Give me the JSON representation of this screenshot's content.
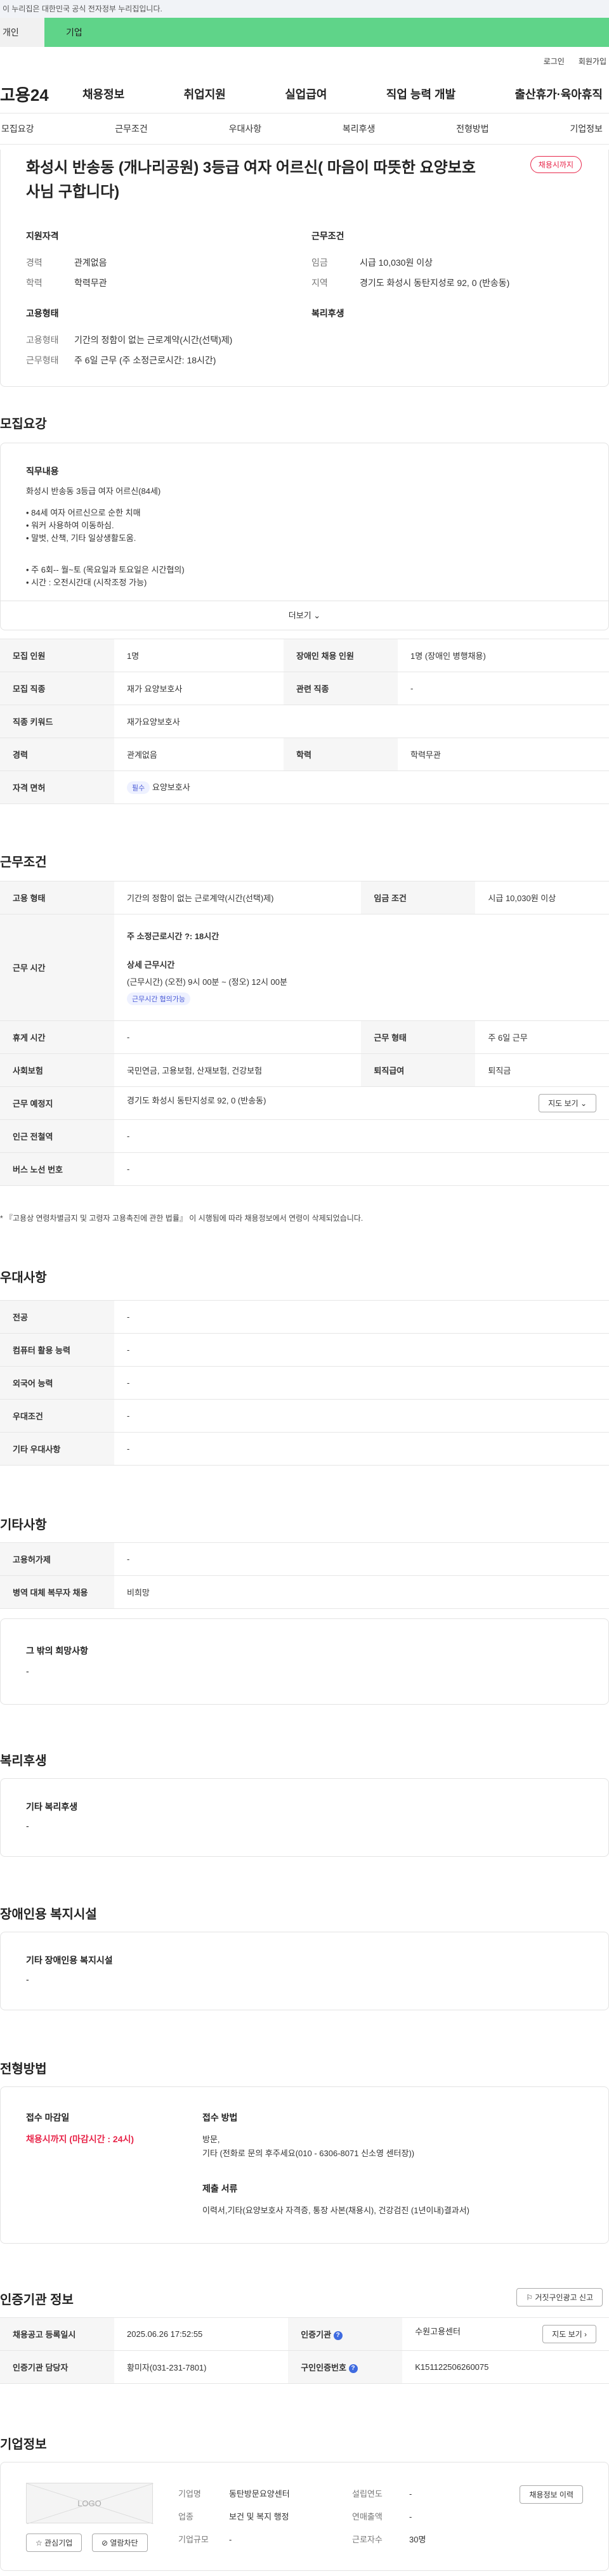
{
  "gov_banner": "이 누리집은 대한민국 공식 전자정부 누리집입니다.",
  "tabs": {
    "tab1": "개인",
    "tab2": "기업"
  },
  "util": {
    "login": "로그인",
    "signup": "회원가입"
  },
  "logo": "고용24",
  "gnb": [
    "채용정보",
    "취업지원",
    "실업급여",
    "직업 능력 개발",
    "출산휴가·육아휴직"
  ],
  "subnav": [
    "모집요강",
    "근무조건",
    "우대사항",
    "복리후생",
    "전형방법",
    "기업정보"
  ],
  "hero": {
    "title": "화성시 반송동 (개나리공원) 3등급 여자 어르신( 마음이 따뜻한 요양보호사님 구합니다)",
    "badge": "채용시까지",
    "qual_title": "지원자격",
    "career_k": "경력",
    "career_v": "관계없음",
    "edu_k": "학력",
    "edu_v": "학력무관",
    "emp_title": "고용형태",
    "emptype_k": "고용형태",
    "emptype_v": "기간의 정함이 없는 근로계약(시간(선택)제)",
    "worktype_k": "근무형태",
    "worktype_v": "주 6일 근무 (주 소정근로시간: 18시간)",
    "cond_title": "근무조건",
    "wage_k": "임금",
    "wage_v": "시급 10,030원 이상",
    "area_k": "지역",
    "area_v": "경기도 화성시 동탄지성로 92, 0 (반송동)",
    "welfare_title": "복리후생"
  },
  "recruit": {
    "section": "모집요강",
    "job_title": "직무내용",
    "lines": [
      "화성시 반송동 3등급 여자 어르신(84세)",
      "• 84세 여자 어르신으로 순한 치매",
      "• 워커 사용하여 이동하심.",
      "• 말벗, 산책, 기타 일상생활도움.",
      "• 주 6회-- 월~토 (목요일과 토요일은 시간협의)",
      "• 시간 : 오전시간대 (시작조정 가능)"
    ],
    "more": "더보기",
    "rows": [
      {
        "k1": "모집 인원",
        "v1": "1명",
        "k2": "장애인 채용 인원",
        "v2": "1명 (장애인 병행채용)"
      },
      {
        "k1": "모집 직종",
        "v1": "재가 요양보호사",
        "k2": "관련 직종",
        "v2": "-"
      },
      {
        "k1": "직종 키워드",
        "v1": "재가요양보호사"
      },
      {
        "k1": "경력",
        "v1": "관계없음",
        "k2": "학력",
        "v2": "학력무관"
      },
      {
        "k1": "자격 면허",
        "chip": "필수",
        "v1": "요양보호사"
      }
    ]
  },
  "work": {
    "section": "근무조건",
    "emptype_k": "고용 형태",
    "emptype_v": "기간의 정함이 없는 근로계약(시간(선택)제)",
    "wage_k": "임금 조건",
    "wage_v": "시급 10,030원 이상",
    "hours_k": "근무 시간",
    "hours_weekly": "주 소정근로시간 ?: 18시간",
    "hours_detail_title": "상세 근무시간",
    "hours_detail": "(근무시간) (오전) 9시 00분 ~ (정오) 12시 00분",
    "hours_chip": "근무시간 협의가능",
    "holiday_k": "휴게 시간",
    "holiday_v": "-",
    "form_k": "근무 형태",
    "form_v": "주 6일 근무",
    "insurance_k": "사회보험",
    "insurance_v": "국민연금, 고용보험, 산재보험, 건강보험",
    "retire_k": "퇴직급여",
    "retire_v": "퇴직금",
    "place_k": "근무 예정지",
    "place_v": "경기도 화성시 동탄지성로 92, 0 (반송동)",
    "map_btn": "지도 보기",
    "station_k": "인근 전철역",
    "station_v": "-",
    "bus_k": "버스 노선 번호",
    "bus_v": "-",
    "note": "* 『고용상 연령차별금지 및 고령자 고용촉진에 관한 법률』 이 시행됨에 따라 채용정보에서 연령이 삭제되었습니다."
  },
  "pref": {
    "section": "우대사항",
    "rows": [
      [
        "전공",
        "-"
      ],
      [
        "컴퓨터 활용 능력",
        "-"
      ],
      [
        "외국어 능력",
        "-"
      ],
      [
        "우대조건",
        "-"
      ],
      [
        "기타 우대사항",
        "-"
      ]
    ]
  },
  "etc": {
    "section": "기타사항",
    "rows": [
      [
        "고용허가제",
        "-"
      ],
      [
        "병역 대체 복무자 채용",
        "비희망"
      ]
    ],
    "box_title": "그 밖의 희망사항",
    "box_value": "-"
  },
  "welfare": {
    "section": "복리후생",
    "box_title": "기타 복리후생",
    "box_value": "-"
  },
  "disab": {
    "section": "장애인용 복지시설",
    "box_title": "기타 장애인용 복지시설",
    "box_value": "-"
  },
  "process": {
    "section": "전형방법",
    "deadline_t": "접수 마감일",
    "deadline_v": "채용시까지 (마감시간 : 24시)",
    "method_t": "접수 방법",
    "method_v1": "방문,",
    "method_v2": "기타 (전화로 문의 후주세요(010 - 6306-8071 신소영 센터장))",
    "docs_t": "제출 서류",
    "docs_v": "이력서,기타(요양보호사 자격증, 통장 사본(채용시), 건강검진 (1년이내)결과서)"
  },
  "cert": {
    "section": "인증기관 정보",
    "report_btn": "거짓구인광고 신고",
    "reg_k": "채용공고 등록일시",
    "reg_v": "2025.06.26 17:52:55",
    "org_k": "인증기관",
    "org_v": "수원고용센터",
    "map_btn": "지도 보기",
    "mgr_k": "인증기관 담당자",
    "mgr_v": "황미자(031-231-7801)",
    "no_k": "구인인증번호",
    "no_v": "K151122506260075"
  },
  "company": {
    "section": "기업정보",
    "logo": "LOGO",
    "interest_btn": "관심기업",
    "block_btn": "열람차단",
    "name_k": "기업명",
    "name_v": "동탄방문요양센터",
    "year_k": "설립연도",
    "year_v": "-",
    "biz_k": "업종",
    "biz_v": "보건 및 복지 행정",
    "sales_k": "연매출액",
    "sales_v": "-",
    "size_k": "기업규모",
    "size_v": "-",
    "emp_k": "근로자수",
    "emp_v": "30명",
    "list_btn": "채용정보 이력"
  }
}
